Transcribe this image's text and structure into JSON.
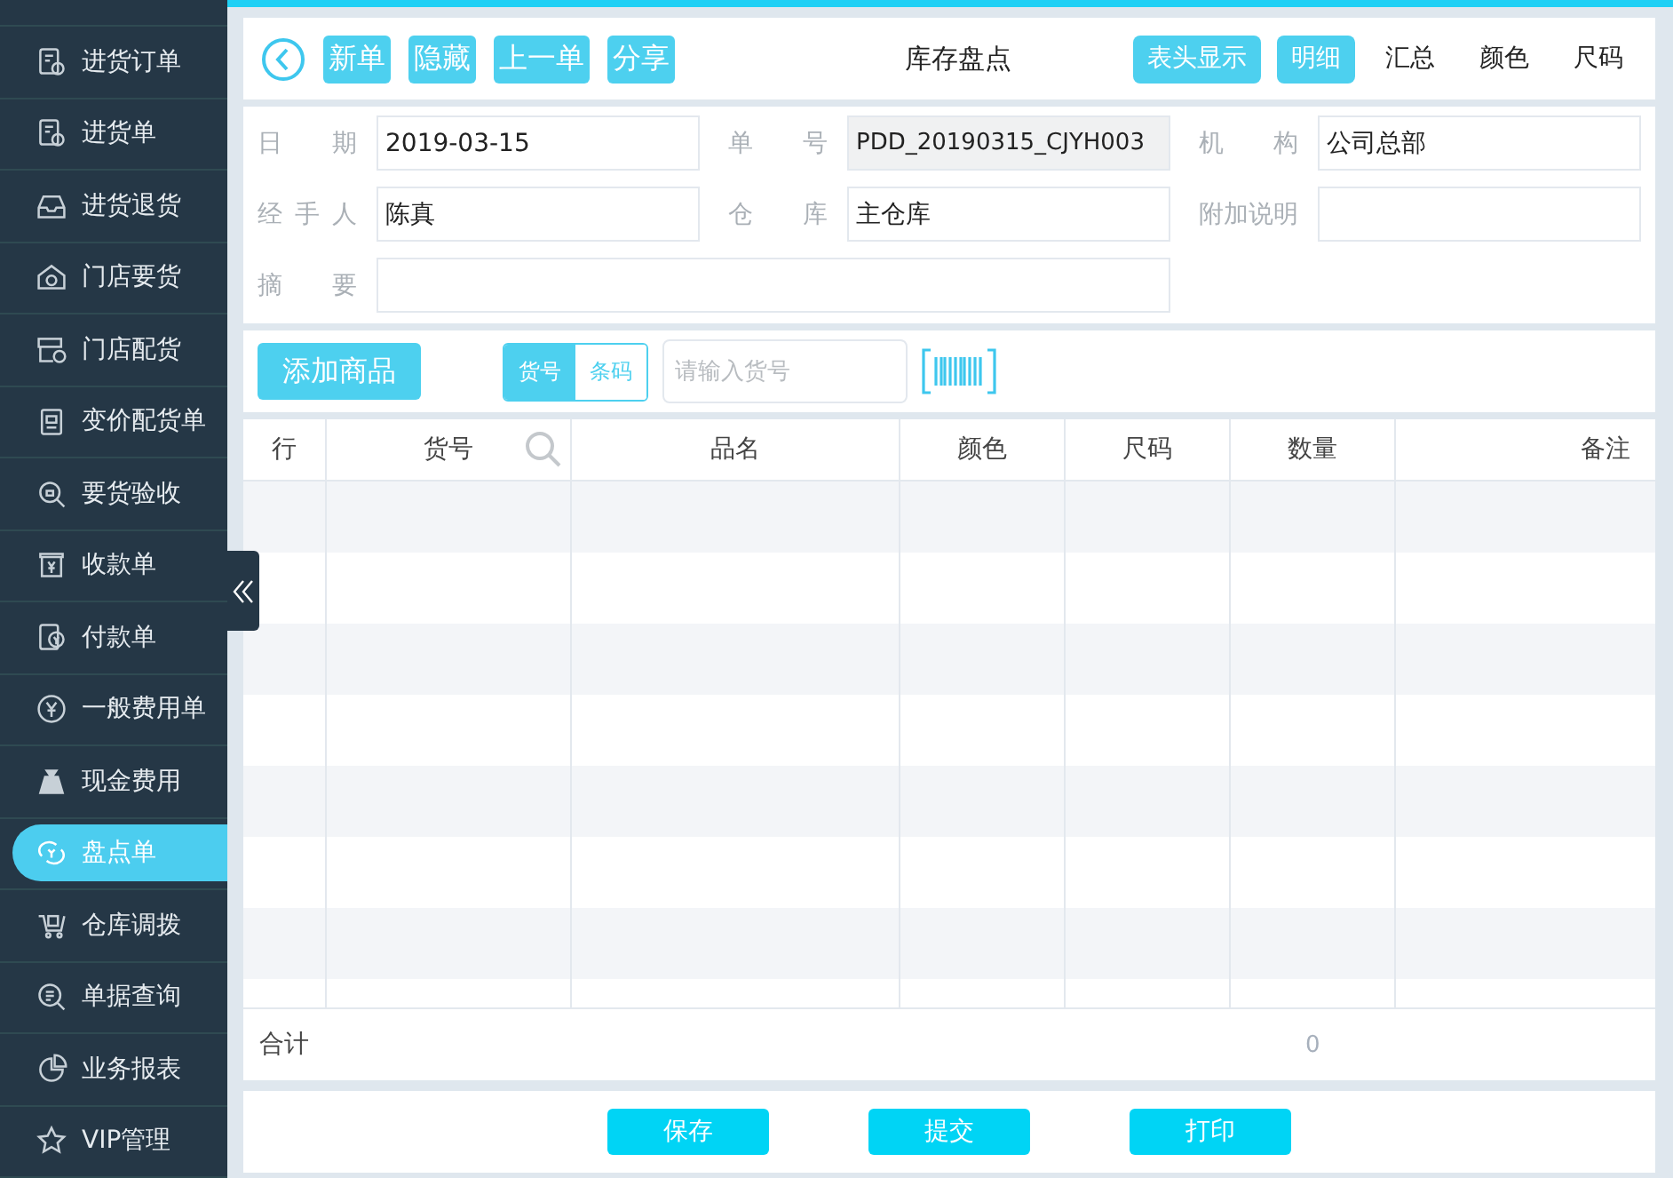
{
  "sidebar": {
    "items": [
      {
        "label": "进货订单",
        "selected": false
      },
      {
        "label": "进货单",
        "selected": false
      },
      {
        "label": "进货退货",
        "selected": false
      },
      {
        "label": "门店要货",
        "selected": false
      },
      {
        "label": "门店配货",
        "selected": false
      },
      {
        "label": "变价配货单",
        "selected": false
      },
      {
        "label": "要货验收",
        "selected": false
      },
      {
        "label": "收款单",
        "selected": false
      },
      {
        "label": "付款单",
        "selected": false
      },
      {
        "label": "一般费用单",
        "selected": false
      },
      {
        "label": "现金费用",
        "selected": false
      },
      {
        "label": "盘点单",
        "selected": true
      },
      {
        "label": "仓库调拨",
        "selected": false
      },
      {
        "label": "单据查询",
        "selected": false
      },
      {
        "label": "业务报表",
        "selected": false
      },
      {
        "label": "VIP管理",
        "selected": false
      }
    ]
  },
  "toolbar": {
    "actions": [
      "新单",
      "隐藏",
      "上一单",
      "分享"
    ],
    "title": "库存盘点",
    "header_toggle": {
      "label": "表头显示",
      "on": true
    },
    "views": [
      {
        "label": "明细",
        "selected": true
      },
      {
        "label": "汇总",
        "selected": false
      },
      {
        "label": "颜色",
        "selected": false
      },
      {
        "label": "尺码",
        "selected": false
      }
    ]
  },
  "form": {
    "fields": [
      {
        "label": "日期",
        "value": "2019-03-15"
      },
      {
        "label": "单号",
        "value": "PDD_20190315_CJYH003",
        "readonly": true
      },
      {
        "label": "机构",
        "value": "公司总部"
      },
      {
        "label": "经手人",
        "value": "陈真"
      },
      {
        "label": "仓库",
        "value": "主仓库"
      },
      {
        "label": "附加说明"
      },
      {
        "label": "摘要",
        "wide": true
      }
    ]
  },
  "add_bar": {
    "add_button": "添加商品",
    "search_modes": [
      {
        "label": "货号",
        "selected": true
      },
      {
        "label": "条码",
        "selected": false
      }
    ],
    "search": {
      "placeholder": "请输入货号"
    }
  },
  "table": {
    "columns": [
      "行",
      "货号",
      "品名",
      "颜色",
      "尺码",
      "数量",
      "备注"
    ],
    "total": {
      "label": "合计",
      "quantity": "0"
    }
  },
  "buttons": [
    "保存",
    "提交",
    "打印"
  ]
}
